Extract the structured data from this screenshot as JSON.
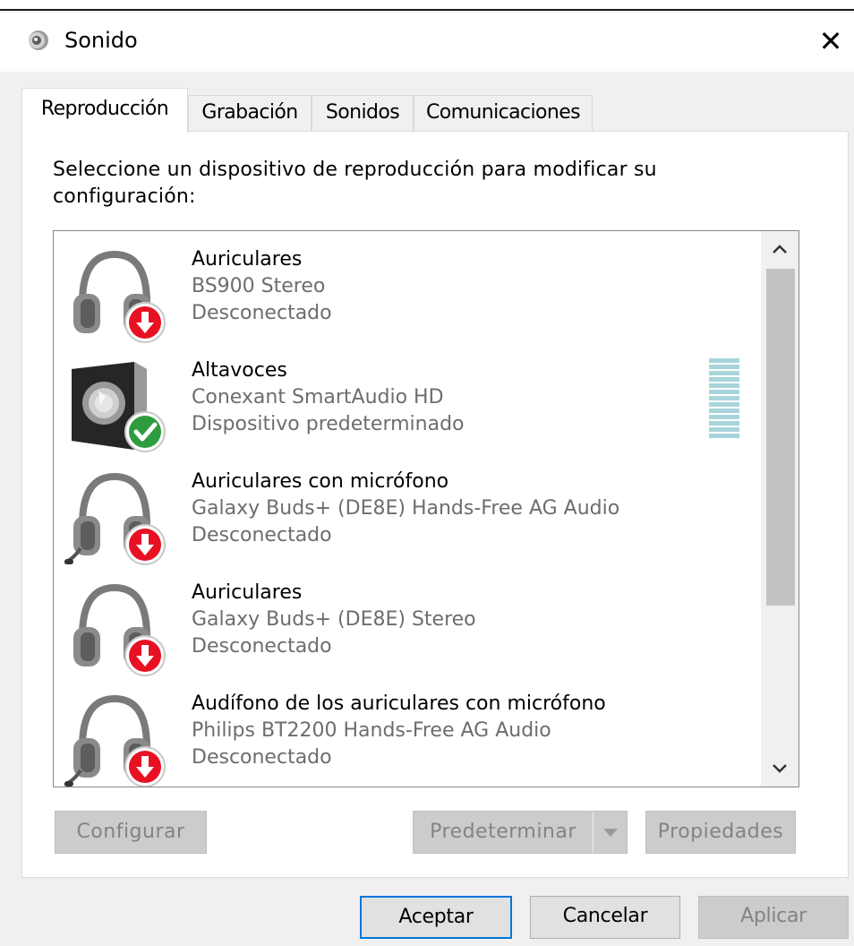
{
  "window": {
    "title": "Sonido",
    "close_glyph": "✕"
  },
  "tabs": [
    {
      "label": "Reproducción",
      "active": true
    },
    {
      "label": "Grabación",
      "active": false
    },
    {
      "label": "Sonidos",
      "active": false
    },
    {
      "label": "Comunicaciones",
      "active": false
    }
  ],
  "instruction": "Seleccione un dispositivo de reproducción para modificar su configuración:",
  "devices": [
    {
      "name": "Auriculares",
      "description": "BS900 Stereo",
      "status": "Desconectado",
      "icon": "headphones-icon",
      "badge": "disconnected-badge"
    },
    {
      "name": "Altavoces",
      "description": "Conexant SmartAudio HD",
      "status": "Dispositivo predeterminado",
      "icon": "speaker-icon",
      "badge": "default-check-badge"
    },
    {
      "name": "Auriculares con micrófono",
      "description": "Galaxy Buds+ (DE8E) Hands-Free AG Audio",
      "status": "Desconectado",
      "icon": "headset-icon",
      "badge": "disconnected-badge"
    },
    {
      "name": "Auriculares",
      "description": "Galaxy Buds+ (DE8E) Stereo",
      "status": "Desconectado",
      "icon": "headphones-icon",
      "badge": "disconnected-badge"
    },
    {
      "name": "Audífono de los auriculares con micrófono",
      "description": "Philips BT2200 Hands-Free AG Audio",
      "status": "Desconectado",
      "icon": "headset-icon",
      "badge": "disconnected-badge"
    }
  ],
  "panel_buttons": {
    "configure": "Configurar",
    "set_default": "Predeterminar",
    "properties": "Propiedades"
  },
  "dialog_buttons": {
    "ok": "Aceptar",
    "cancel": "Cancelar",
    "apply": "Aplicar"
  },
  "colors": {
    "accent": "#0078d7",
    "disconnected": "#e81123",
    "default_check": "#2e9b3f",
    "level_meter": "#a8d5dc"
  }
}
